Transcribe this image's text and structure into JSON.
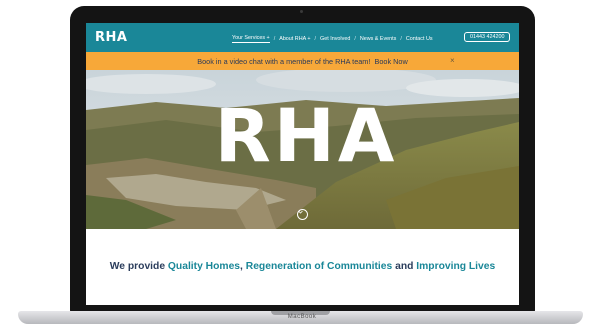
{
  "laptop": {
    "brand": "MacBook"
  },
  "site": {
    "logo": "RHA",
    "nav": [
      {
        "label": "Your Services +",
        "active": true
      },
      {
        "label": "About RHA +"
      },
      {
        "label": "Get Involved"
      },
      {
        "label": "News & Events"
      },
      {
        "label": "Contact Us"
      }
    ],
    "phone": "01443 424200"
  },
  "banner": {
    "text": "Book in a video chat with a member of the RHA team!",
    "link": "Book Now",
    "close": "×"
  },
  "hero": {
    "title": "RHA"
  },
  "tagline": {
    "p1": "We provide ",
    "h1": "Quality Homes",
    "p2": ", ",
    "h2": "Regeneration of Communities",
    "p3": " and ",
    "h3": "Improving Lives"
  },
  "colors": {
    "teal": "#1a8798",
    "orange": "#f7a839",
    "navy": "#2b3d5c"
  }
}
